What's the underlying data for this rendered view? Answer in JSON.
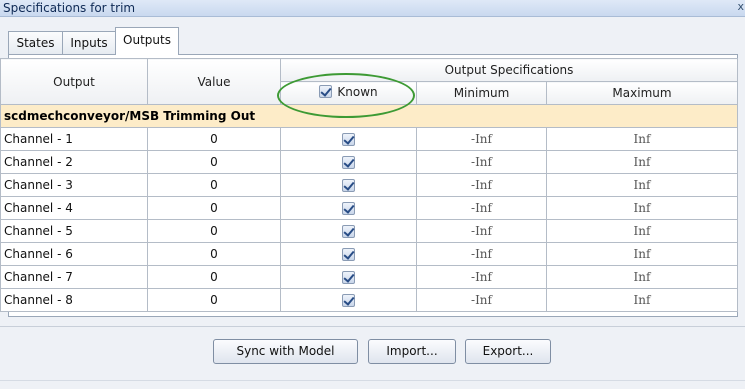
{
  "window": {
    "title": "Specifications for trim",
    "close_glyph": "x"
  },
  "tabs": [
    {
      "label": "States",
      "active": false
    },
    {
      "label": "Inputs",
      "active": false
    },
    {
      "label": "Outputs",
      "active": true
    }
  ],
  "table": {
    "columns": {
      "output": "Output",
      "value": "Value",
      "group_header": "Output Specifications",
      "known": "Known",
      "known_checked": true,
      "minimum": "Minimum",
      "maximum": "Maximum"
    },
    "group_label": "scdmechconveyor/MSB Trimming Out",
    "rows": [
      {
        "output": "Channel - 1",
        "value": "0",
        "known": true,
        "min": "-Inf",
        "max": "Inf"
      },
      {
        "output": "Channel - 2",
        "value": "0",
        "known": true,
        "min": "-Inf",
        "max": "Inf"
      },
      {
        "output": "Channel - 3",
        "value": "0",
        "known": true,
        "min": "-Inf",
        "max": "Inf"
      },
      {
        "output": "Channel - 4",
        "value": "0",
        "known": true,
        "min": "-Inf",
        "max": "Inf"
      },
      {
        "output": "Channel - 5",
        "value": "0",
        "known": true,
        "min": "-Inf",
        "max": "Inf"
      },
      {
        "output": "Channel - 6",
        "value": "0",
        "known": true,
        "min": "-Inf",
        "max": "Inf"
      },
      {
        "output": "Channel - 7",
        "value": "0",
        "known": true,
        "min": "-Inf",
        "max": "Inf"
      },
      {
        "output": "Channel - 8",
        "value": "0",
        "known": true,
        "min": "-Inf",
        "max": "Inf"
      }
    ]
  },
  "buttons": {
    "sync": "Sync with Model",
    "import": "Import...",
    "export": "Export..."
  },
  "colors": {
    "group_row_bg": "#fdecc8",
    "highlight_ellipse": "#3d9a34",
    "title_text": "#0f2a55"
  }
}
